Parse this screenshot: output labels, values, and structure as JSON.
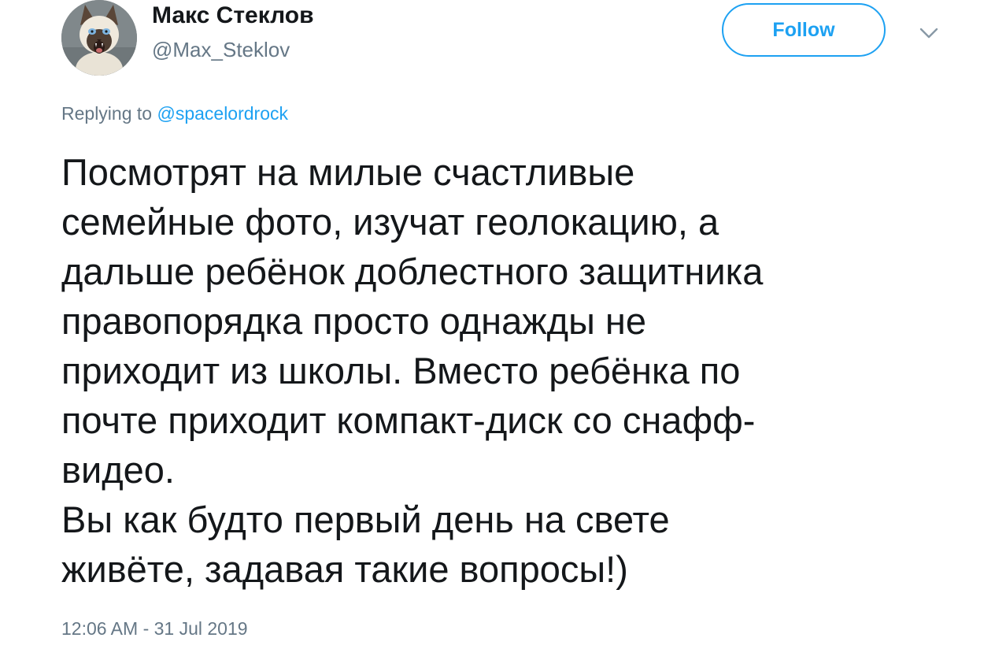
{
  "author": {
    "display_name": "Макс Стеклов",
    "handle": "@Max_Steklov",
    "avatar_icon": "siamese-cat-avatar"
  },
  "actions": {
    "follow_label": "Follow",
    "menu_icon": "chevron-down-icon"
  },
  "reply": {
    "prefix": "Replying to",
    "mention": "@spacelordrock"
  },
  "tweet": {
    "paragraph_1": "Посмотрят на милые счастливые\nсемейные фото, изучат геолокацию, а\nдальше ребёнок доблестного защитника\nправопорядка просто однажды не\nприходит из школы. Вместо ребёнка по\nпочте приходит компакт-диск со снафф-\nвидео.",
    "paragraph_2": "Вы как будто первый день на свете\nживёте, задавая такие вопросы!)"
  },
  "meta": {
    "timestamp": "12:06 AM - 31 Jul 2019"
  },
  "colors": {
    "accent": "#1da1f2",
    "text": "#14171a",
    "muted": "#657786"
  }
}
